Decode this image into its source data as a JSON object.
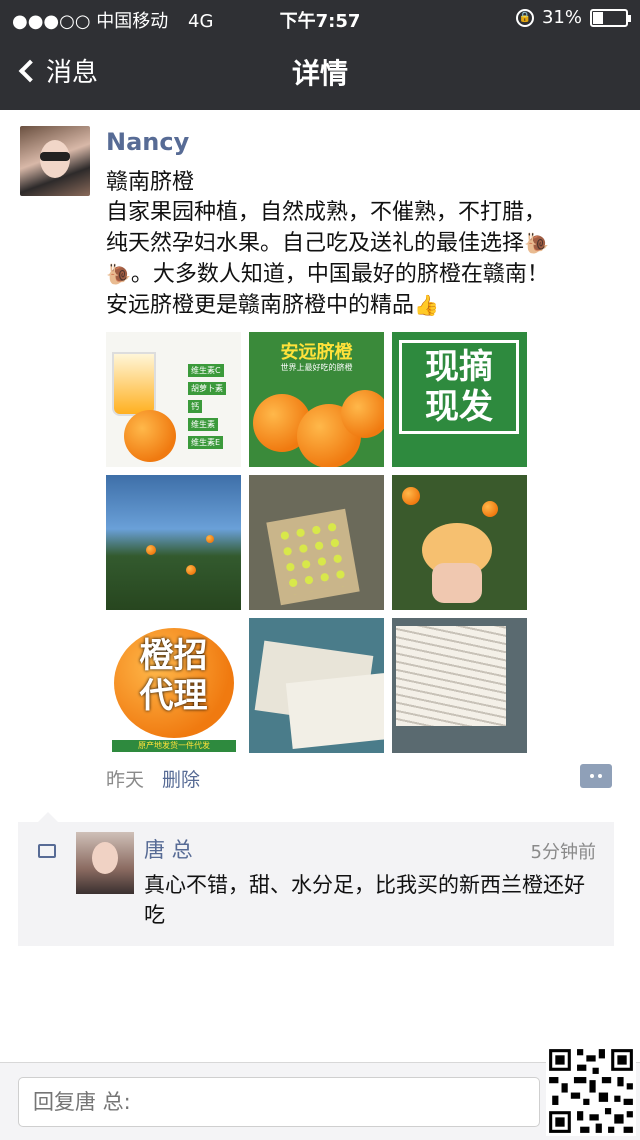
{
  "status_bar": {
    "carrier": "●●●○○ 中国移动",
    "network": "4G",
    "time": "下午7:57",
    "battery": "31%",
    "battery_level": 0.31
  },
  "nav": {
    "back_label": "消息",
    "title": "详情"
  },
  "post": {
    "author": "Nancy",
    "lines": [
      "赣南脐橙",
      "自家果园种植，自然成熟，不催熟，不打腊，",
      "纯天然孕妇水果。自己吃及送礼的最佳选择",
      "。大多数人知道，中国最好的脐橙在赣南！",
      "安远脐橙更是赣南脐橙中的精品"
    ],
    "image_texts": {
      "tile1_tags": [
        "维生素C",
        "胡萝卜素",
        "钙",
        "维生素",
        "维生素E"
      ],
      "tile2_title": "安远脐橙",
      "tile2_subtitle": "世界上最好吃的脐橙",
      "tile3_line1": "现摘",
      "tile3_line2": "现发",
      "tile7_line1": "橙招",
      "tile7_line2": "代理",
      "tile7_caption": "原产地发货一件代发"
    },
    "time": "昨天",
    "delete_label": "删除"
  },
  "comment": {
    "name": "唐 总",
    "time": "5分钟前",
    "text": "真心不错，甜、水分足，比我买的新西兰橙还好吃"
  },
  "reply": {
    "placeholder": "回复唐 总:"
  }
}
